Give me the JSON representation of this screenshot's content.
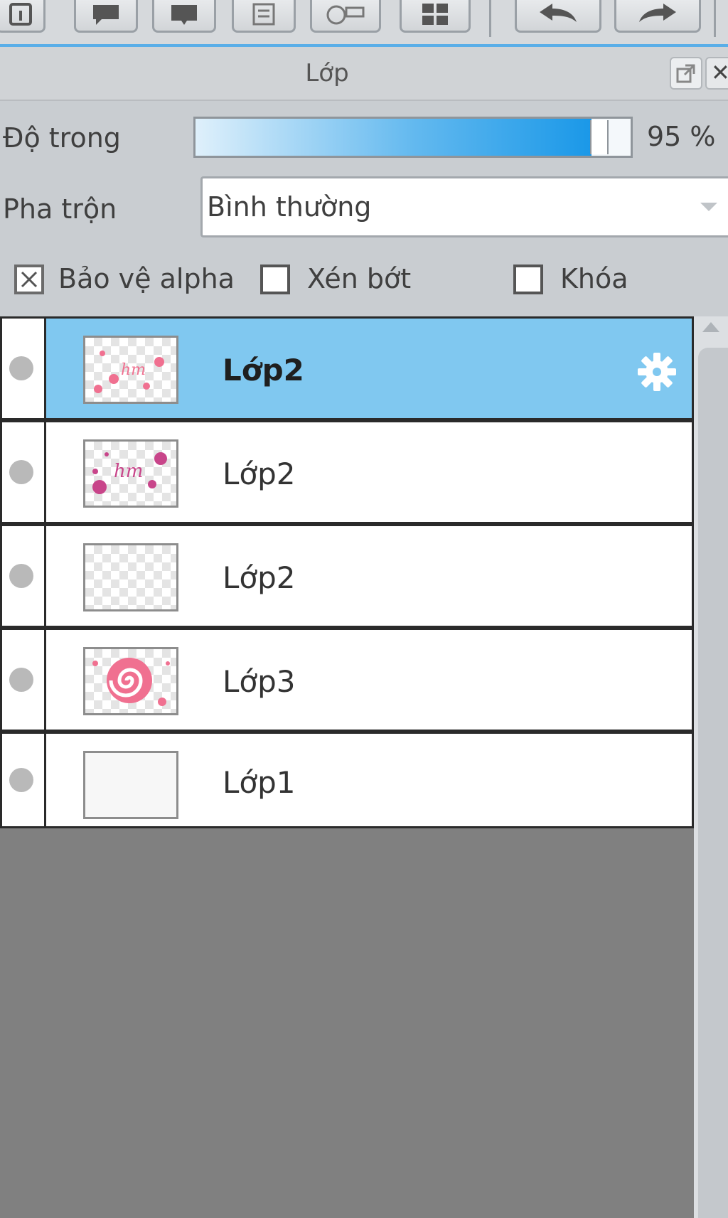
{
  "panel": {
    "title": "Lớp"
  },
  "toolbar": {
    "buttons": [
      {
        "icon": "info-icon"
      },
      {
        "icon": "speech-bubble-icon"
      },
      {
        "icon": "book-icon"
      },
      {
        "icon": "document-icon"
      },
      {
        "icon": "timer-icon"
      },
      {
        "icon": "grid-icon"
      },
      {
        "icon": "undo-icon"
      },
      {
        "icon": "redo-icon"
      }
    ]
  },
  "opacity": {
    "label": "Độ trong",
    "value": 95,
    "value_text": "95 %"
  },
  "blend": {
    "label": "Pha trộn",
    "selected": "Bình thường"
  },
  "options": {
    "protect_alpha": {
      "label": "Bảo vệ alpha",
      "checked": true
    },
    "clipping": {
      "label": "Xén bớt",
      "checked": false
    },
    "lock": {
      "label": "Khóa",
      "checked": false
    }
  },
  "layers": [
    {
      "name": "Lớp2",
      "selected": true,
      "thumbnail": "pink-hm-text-light",
      "settings_icon": "gear-icon"
    },
    {
      "name": "Lớp2",
      "selected": false,
      "thumbnail": "magenta-hm-text"
    },
    {
      "name": "Lớp2",
      "selected": false,
      "thumbnail": "empty-transparent"
    },
    {
      "name": "Lớp3",
      "selected": false,
      "thumbnail": "pink-swirl"
    },
    {
      "name": "Lớp1",
      "selected": false,
      "thumbnail": "blank-white"
    }
  ],
  "colors": {
    "accent": "#59aee8",
    "selected_row": "#80c8f0",
    "list_background": "#808080",
    "thumbnail_pink": "#f07090",
    "thumbnail_magenta": "#c8458a"
  }
}
